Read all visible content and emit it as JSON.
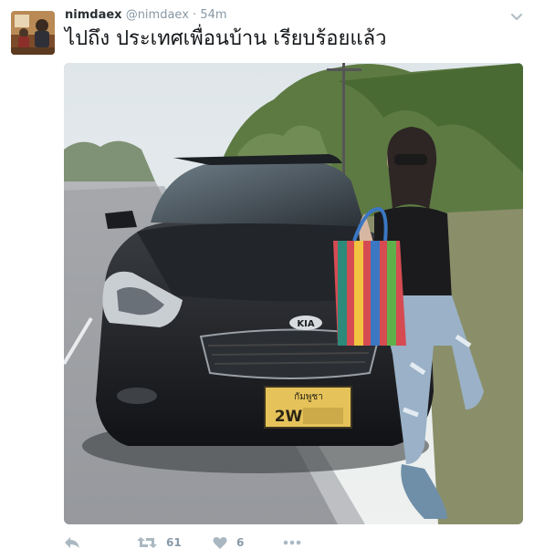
{
  "tweet": {
    "display_name": "nimdaex",
    "handle": "@nimdaex",
    "separator": "·",
    "time": "54m",
    "text": "ไปถึง ประเทศเพื่อนบ้าน เรียบร้อยแล้ว",
    "retweet_count": "61",
    "like_count": "6"
  },
  "media": {
    "car_badge": "KIA",
    "plate_top": "กัมพูชา",
    "plate_main": "2W"
  },
  "icons": {
    "reply": "reply-icon",
    "retweet": "retweet-icon",
    "like": "heart-icon",
    "more": "more-icon",
    "menu": "chevron-down-icon"
  },
  "colors": {
    "name": "#292f33",
    "meta": "#8899a6",
    "text": "#14171a"
  }
}
